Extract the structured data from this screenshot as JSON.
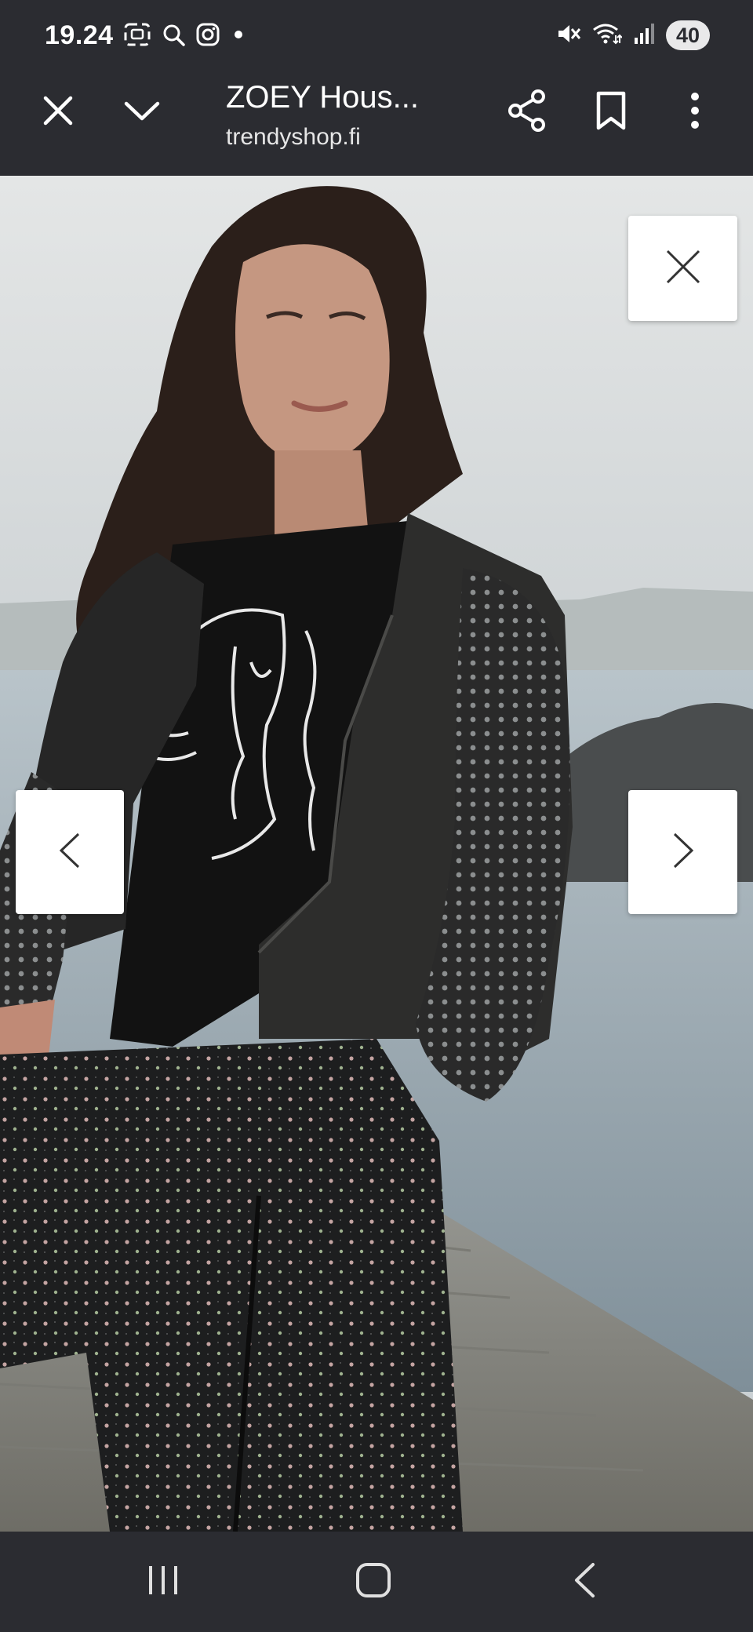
{
  "status_bar": {
    "time": "19.24",
    "battery_level": "40",
    "icons_left": [
      "screenshot-icon",
      "search-icon",
      "instagram-icon",
      "notification-dot-icon"
    ],
    "icons_right": [
      "mute-icon",
      "wifi-icon",
      "signal-icon",
      "battery-icon"
    ]
  },
  "toolbar": {
    "title": "ZOEY Hous...",
    "domain": "trendyshop.fi",
    "close_icon": "close-icon",
    "collapse_icon": "chevron-down-icon",
    "share_icon": "share-icon",
    "bookmark_icon": "bookmark-icon",
    "menu_icon": "more-vert-icon"
  },
  "viewer": {
    "image_alt": "Woman wearing studded black leather jacket and floral trousers on a pier",
    "close_icon": "close-icon",
    "prev_icon": "chevron-left-icon",
    "next_icon": "chevron-right-icon"
  },
  "nav_bar": {
    "recents_icon": "recents-icon",
    "home_icon": "home-icon",
    "back_icon": "back-icon"
  },
  "colors": {
    "chrome_bg": "#2b2c31",
    "text": "#ffffff",
    "overlay_button": "#ffffff",
    "overlay_icon": "#333333"
  }
}
